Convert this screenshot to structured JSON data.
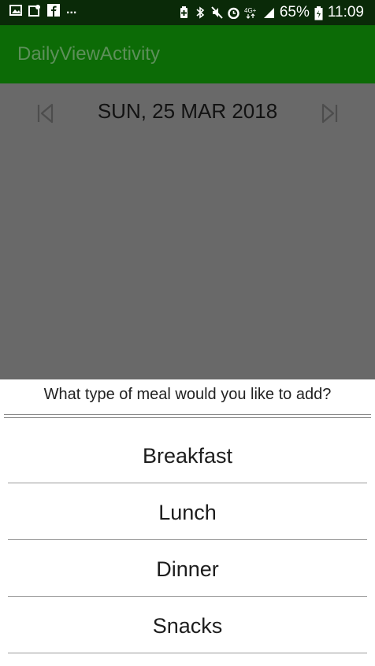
{
  "status_bar": {
    "notification_icons": [
      "gallery-icon",
      "location-edit-icon",
      "facebook-icon"
    ],
    "more": "...",
    "system_icons": [
      "battery-saver-icon",
      "bluetooth-icon",
      "mute-icon",
      "alarm-icon",
      "4g-lte-icon",
      "signal-icon"
    ],
    "network": "4G+",
    "battery": "65%",
    "time": "11:09"
  },
  "app_bar": {
    "title": "DailyViewActivity"
  },
  "date_nav": {
    "date": "SUN, 25 MAR 2018",
    "prev_icon": "skip-previous-icon",
    "next_icon": "skip-next-icon"
  },
  "dialog": {
    "title": "What type of meal would you like to add?",
    "options": [
      "Breakfast",
      "Lunch",
      "Dinner",
      "Snacks"
    ]
  },
  "colors": {
    "status_bar": "#0a2a08",
    "app_bar": "#0c6b06",
    "scrim": "#696969"
  }
}
